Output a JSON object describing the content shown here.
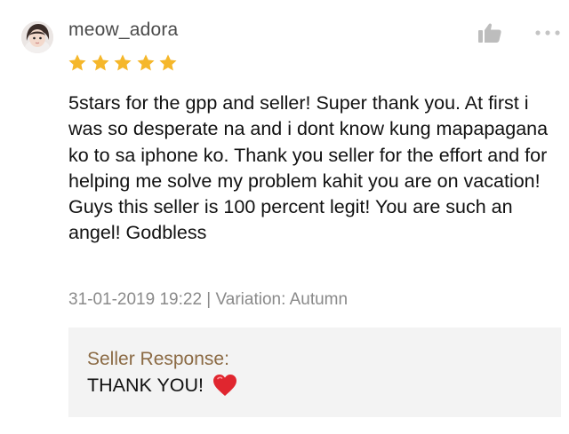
{
  "review": {
    "username": "meow_adora",
    "rating": 5,
    "rating_max": 5,
    "comment": "5stars for the gpp and seller! Super thank you. At first i was so desperate na and i dont know kung mapapagana ko to sa iphone ko. Thank you seller for the effort and for helping me solve my problem kahit you are on vacation! Guys this seller is 100 percent legit! You are such an angel! Godbless",
    "meta": "31-01-2019 19:22 | Variation: Autumn",
    "seller_response": {
      "title": "Seller Response:",
      "text": "THANK YOU!",
      "emoji_icon": "red-heart-icon"
    }
  },
  "icons": {
    "like": "thumbs-up-icon",
    "more": "more-options-icon",
    "star": "star-icon",
    "avatar": "user-avatar"
  },
  "colors": {
    "star": "#f5b72b",
    "icon_gray": "#bdbdbd",
    "seller_response_title": "#8b6a44",
    "meta_text": "#8a8a8a",
    "response_background": "#f3f3f3",
    "heart": "#e0262f"
  }
}
